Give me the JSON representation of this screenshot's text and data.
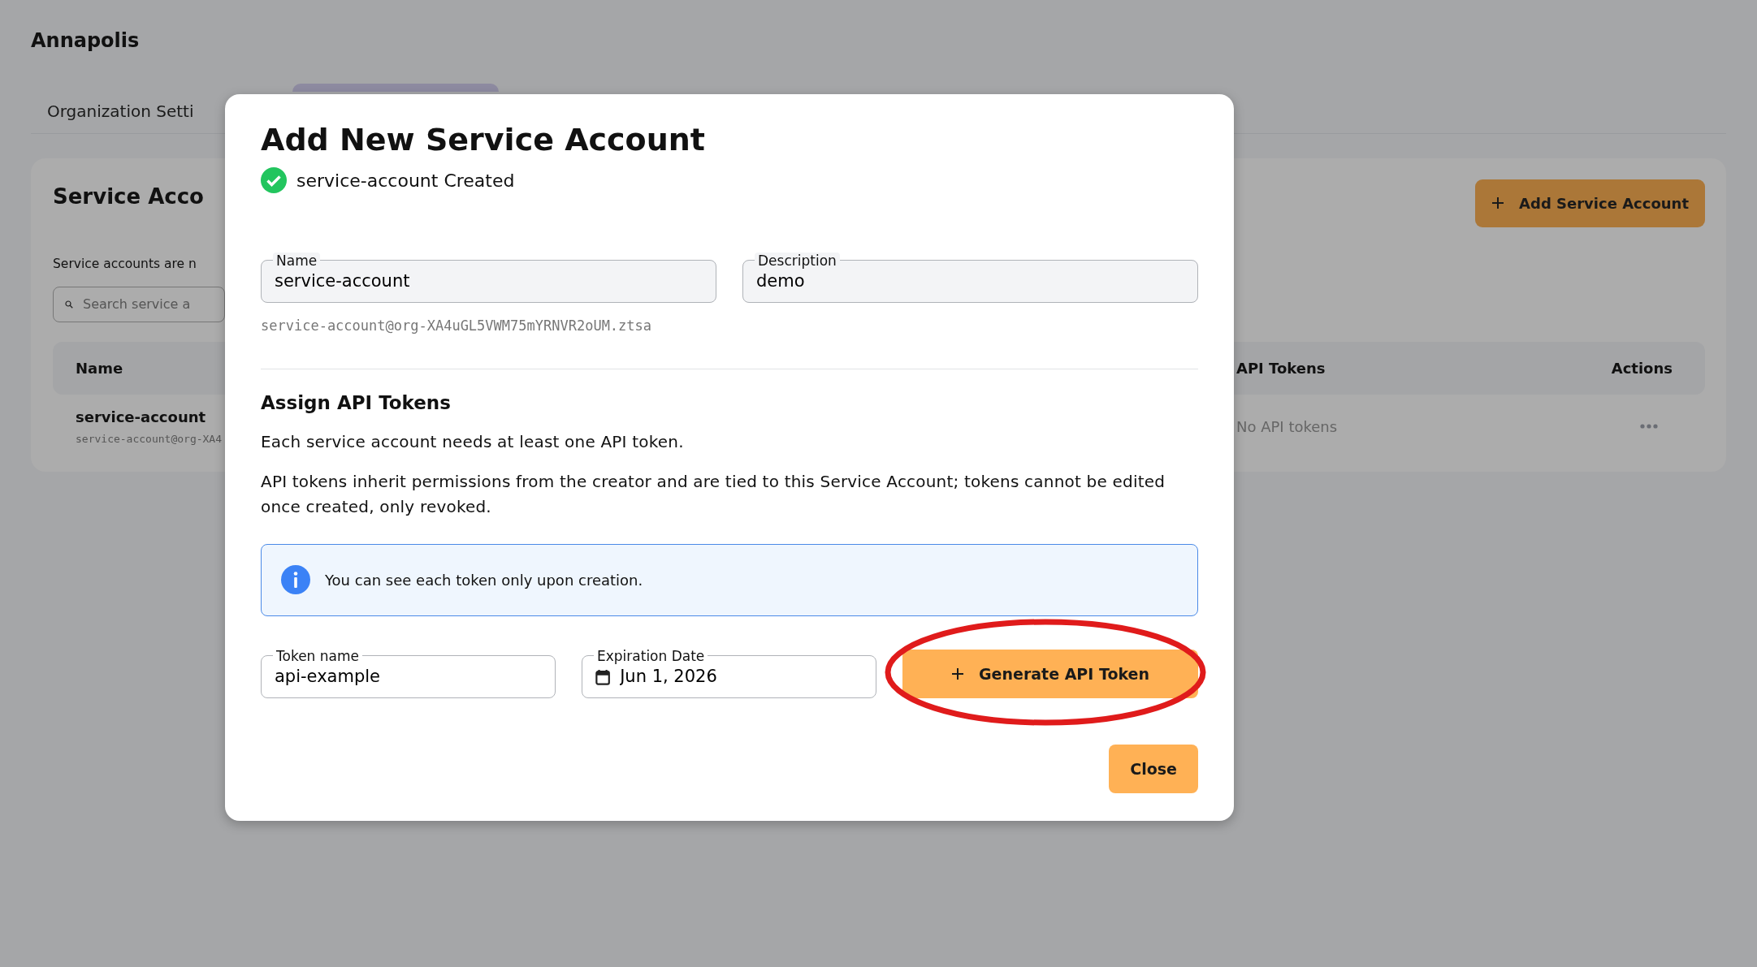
{
  "app": {
    "title": "Annapolis"
  },
  "tabs": [
    {
      "label": "Organization Setti",
      "selected": false
    },
    {
      "selected": true
    }
  ],
  "page": {
    "title": "Service Acco",
    "description": "Service accounts are n",
    "add_button": "Add Service Account",
    "search": {
      "placeholder": "Search service a"
    }
  },
  "table": {
    "columns": [
      "Name",
      "API Tokens",
      "Actions"
    ],
    "rows": [
      {
        "name": "service-account",
        "email": "service-account@org-XA4",
        "api_tokens": "No API tokens"
      }
    ]
  },
  "dialog": {
    "title": "Add New Service Account",
    "status": {
      "kind": "success",
      "text": "service-account Created"
    },
    "fields": [
      {
        "label": "Name",
        "value": "service-account",
        "disabled": true
      },
      {
        "label": "Description",
        "value": "demo",
        "disabled": true
      }
    ],
    "email": "service-account@org-XA4uGL5VWM75mYRNVR2oUM.ztsa",
    "section_title": "Assign API Tokens",
    "paragraphs": [
      "Each service account needs at least one API token.",
      "API tokens inherit permissions from the creator and are tied to this Service Account; tokens cannot be edited once created, only revoked."
    ],
    "alert": {
      "kind": "info",
      "text": "You can see each token only upon creation."
    },
    "token_form": {
      "token_name": {
        "label": "Token name",
        "value": "api-example",
        "disabled": false
      },
      "expiration": {
        "label": "Expiration Date",
        "value": "Jun 1, 2026",
        "disabled": false
      },
      "generate_button": "Generate API Token"
    },
    "close_button": "Close"
  }
}
